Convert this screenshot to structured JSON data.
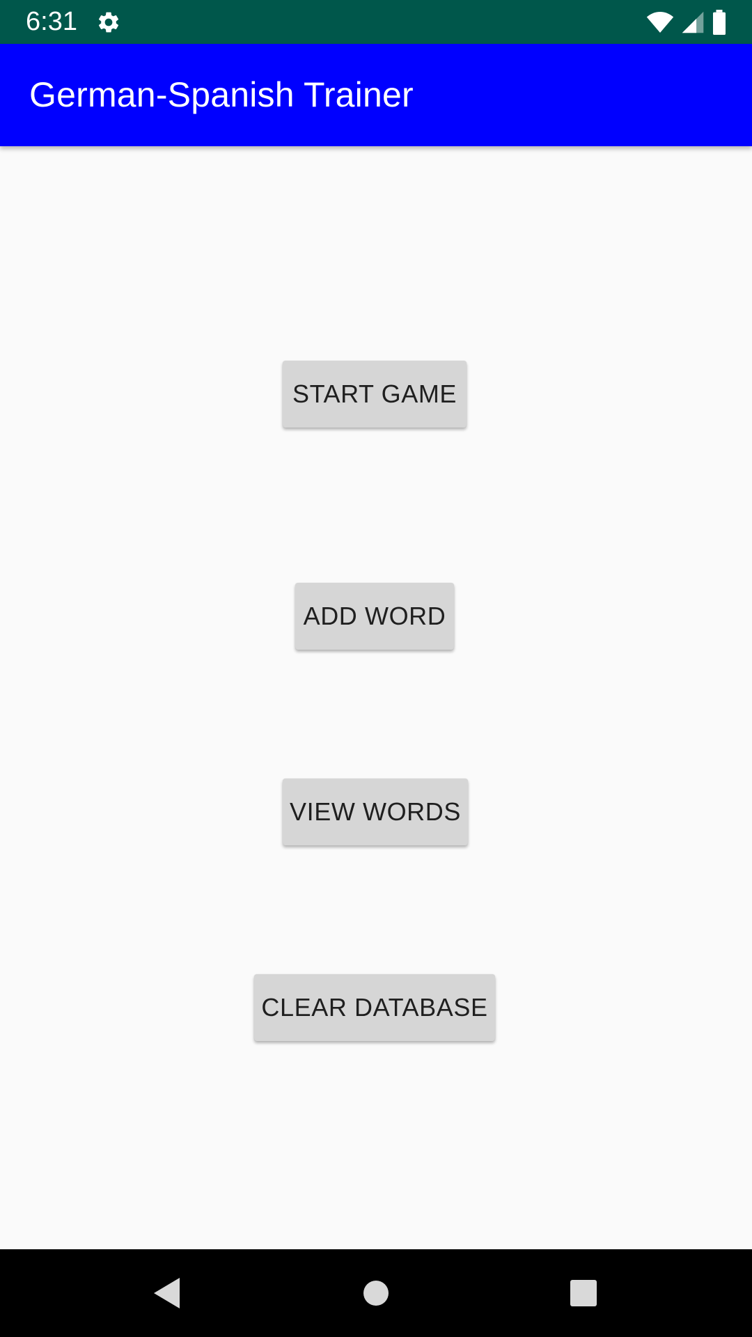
{
  "status_bar": {
    "time": "6:31",
    "icons": [
      "settings-gear-icon",
      "wifi-icon",
      "cell-signal-icon",
      "battery-icon"
    ],
    "background_color": "#00574b"
  },
  "app_bar": {
    "title": "German-Spanish Trainer",
    "background_color": "#0000ff"
  },
  "main": {
    "buttons": [
      {
        "label": "START GAME"
      },
      {
        "label": "ADD WORD"
      },
      {
        "label": "VIEW WORDS"
      },
      {
        "label": "CLEAR DATABASE"
      }
    ]
  },
  "nav_bar": {
    "icons": [
      "back-icon",
      "home-icon",
      "recents-icon"
    ]
  }
}
